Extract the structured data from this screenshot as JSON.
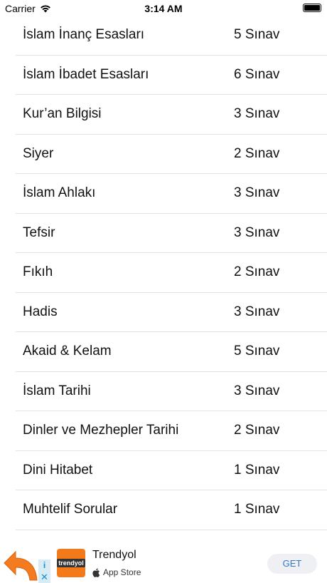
{
  "status_bar": {
    "carrier": "Carrier",
    "time": "3:14 AM"
  },
  "topics": [
    {
      "title": "İslam İnanç Esasları",
      "count": "5 Sınav"
    },
    {
      "title": "İslam İbadet Esasları",
      "count": "6 Sınav"
    },
    {
      "title": "Kur’an Bilgisi",
      "count": "3 Sınav"
    },
    {
      "title": "Siyer",
      "count": "2 Sınav"
    },
    {
      "title": "İslam Ahlakı",
      "count": "3 Sınav"
    },
    {
      "title": "Tefsir",
      "count": "3 Sınav"
    },
    {
      "title": "Fıkıh",
      "count": "2 Sınav"
    },
    {
      "title": "Hadis",
      "count": "3 Sınav"
    },
    {
      "title": "Akaid & Kelam",
      "count": "5 Sınav"
    },
    {
      "title": "İslam Tarihi",
      "count": "3 Sınav"
    },
    {
      "title": "Dinler ve Mezhepler Tarihi",
      "count": "2 Sınav"
    },
    {
      "title": "Dini Hitabet",
      "count": "1 Sınav"
    },
    {
      "title": "Muhtelif Sorular",
      "count": "1 Sınav"
    }
  ],
  "ad": {
    "logo_text": "trendyol",
    "app_name": "Trendyol",
    "store_label": "App Store",
    "get_label": "GET",
    "info_glyph": "i",
    "close_glyph": "✕"
  },
  "colors": {
    "accent_orange": "#f27a1a",
    "get_blue": "#3478c6",
    "divider": "#e3e3e6"
  }
}
